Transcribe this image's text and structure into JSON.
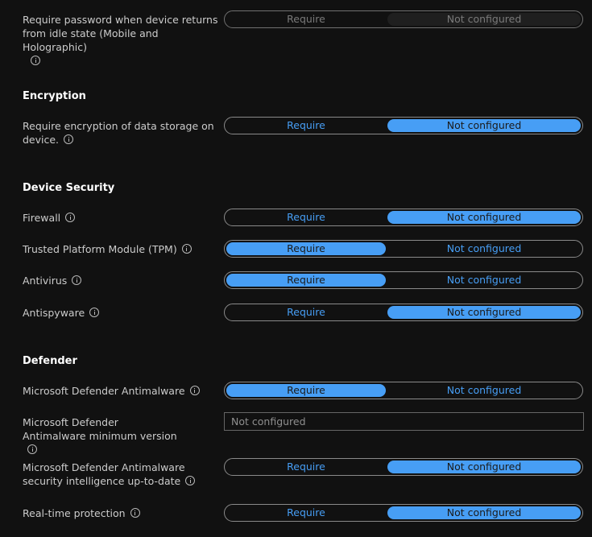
{
  "colors": {
    "background": "#111111",
    "accent": "#479ef5",
    "border": "#8a8a8a"
  },
  "settings": {
    "idle_password": {
      "label": "Require password when device returns from idle state (Mobile and Holographic)",
      "options": [
        "Require",
        "Not configured"
      ],
      "selected": "Not configured",
      "disabled": true
    },
    "encryption_section": "Encryption",
    "encryption": {
      "label": "Require encryption of data storage on device.",
      "options": [
        "Require",
        "Not configured"
      ],
      "selected": "Not configured"
    },
    "device_security_section": "Device Security",
    "firewall": {
      "label": "Firewall",
      "options": [
        "Require",
        "Not configured"
      ],
      "selected": "Not configured"
    },
    "tpm": {
      "label": "Trusted Platform Module (TPM)",
      "options": [
        "Require",
        "Not configured"
      ],
      "selected": "Require"
    },
    "antivirus": {
      "label": "Antivirus",
      "options": [
        "Require",
        "Not configured"
      ],
      "selected": "Require"
    },
    "antispyware": {
      "label": "Antispyware",
      "options": [
        "Require",
        "Not configured"
      ],
      "selected": "Not configured"
    },
    "defender_section": "Defender",
    "defender_antimalware": {
      "label": "Microsoft Defender Antimalware",
      "options": [
        "Require",
        "Not configured"
      ],
      "selected": "Require"
    },
    "defender_min_version": {
      "label": "Microsoft Defender Antimalware minimum version",
      "placeholder": "Not configured"
    },
    "defender_intel": {
      "label": "Microsoft Defender Antimalware security intelligence up-to-date",
      "options": [
        "Require",
        "Not configured"
      ],
      "selected": "Not configured"
    },
    "realtime": {
      "label": "Real-time protection",
      "options": [
        "Require",
        "Not configured"
      ],
      "selected": "Not configured"
    }
  }
}
